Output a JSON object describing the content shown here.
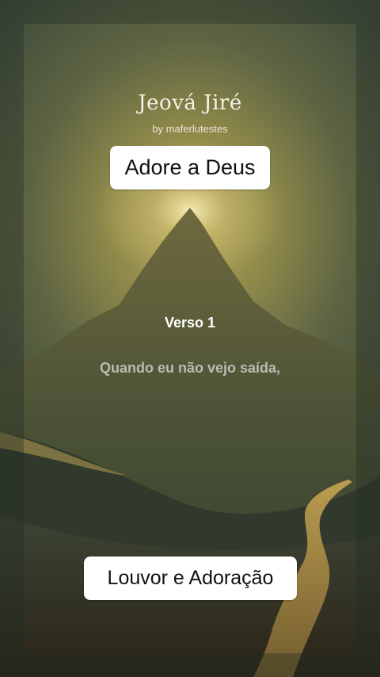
{
  "song": {
    "title": "Jeová Jiré",
    "byline": "by maferlutestes"
  },
  "stickers": {
    "top": "Adore a Deus",
    "bottom": "Louvor e Adoração"
  },
  "lyrics": {
    "section": "Verso 1",
    "line": "Quando eu não vejo saída,"
  }
}
